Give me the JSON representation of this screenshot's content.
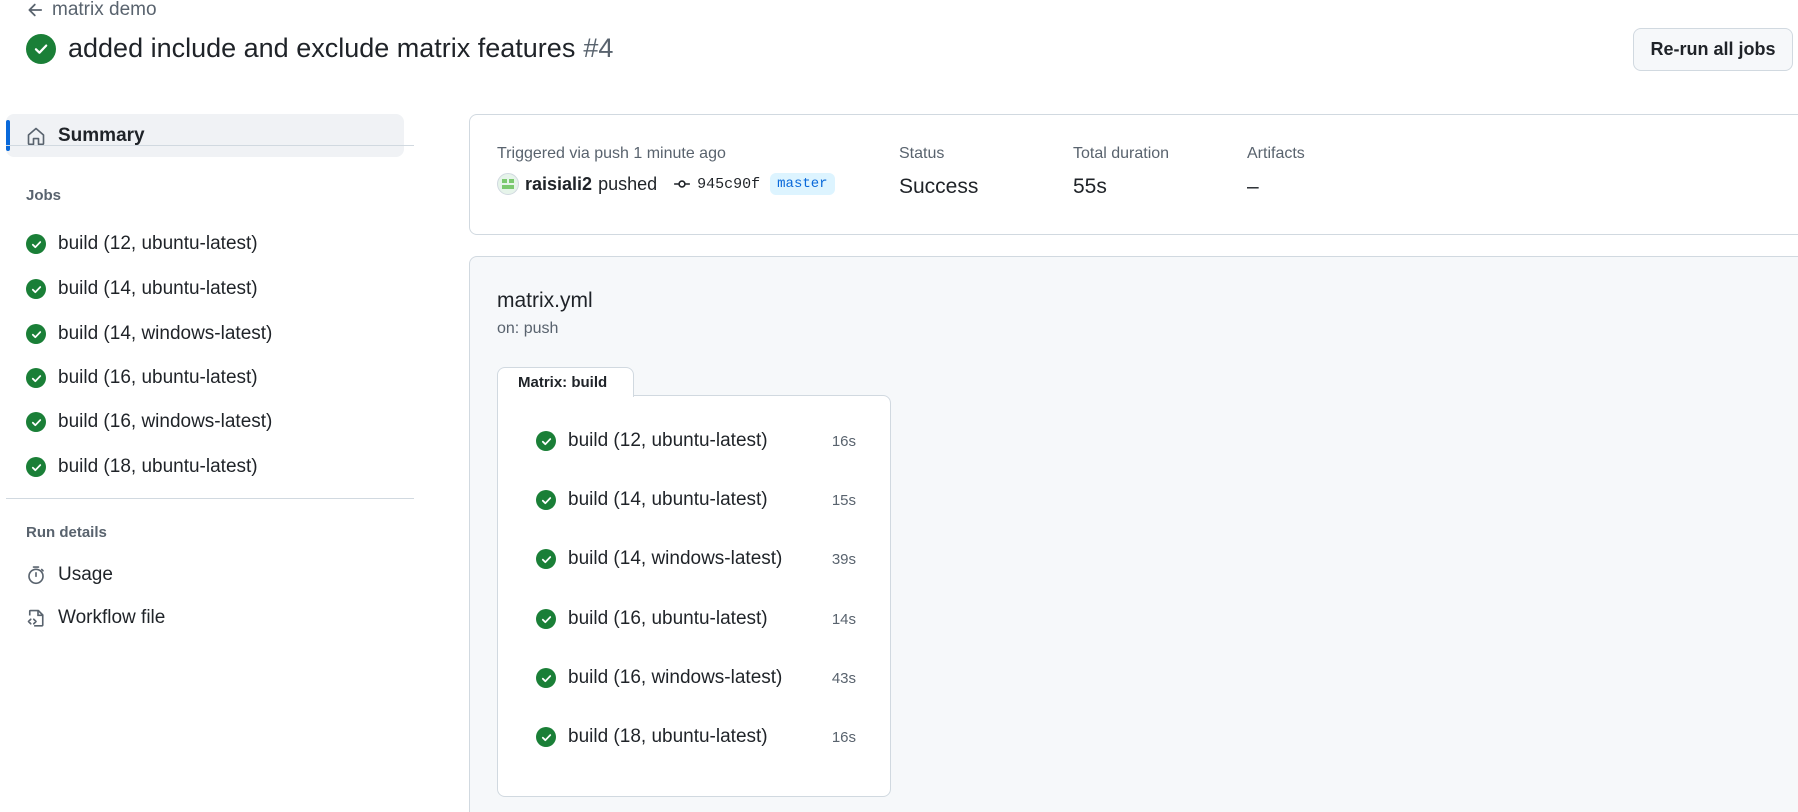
{
  "header": {
    "back_label": "matrix demo",
    "title": "added include and exclude matrix features",
    "run_number": "#4",
    "rerun_label": "Re-run all jobs"
  },
  "sidebar": {
    "summary_label": "Summary",
    "jobs_heading": "Jobs",
    "jobs": [
      {
        "label": "build (12, ubuntu-latest)"
      },
      {
        "label": "build (14, ubuntu-latest)"
      },
      {
        "label": "build (14, windows-latest)"
      },
      {
        "label": "build (16, ubuntu-latest)"
      },
      {
        "label": "build (16, windows-latest)"
      },
      {
        "label": "build (18, ubuntu-latest)"
      }
    ],
    "run_details_heading": "Run details",
    "details": [
      {
        "label": "Usage",
        "icon": "stopwatch-icon"
      },
      {
        "label": "Workflow file",
        "icon": "file-code-icon"
      }
    ]
  },
  "summary": {
    "trigger_label": "Triggered via push 1 minute ago",
    "actor": "raisiali2",
    "action": "pushed",
    "commit": "945c90f",
    "branch": "master",
    "status_label": "Status",
    "status_value": "Success",
    "duration_label": "Total duration",
    "duration_value": "55s",
    "artifacts_label": "Artifacts",
    "artifacts_value": "–"
  },
  "workflow": {
    "name": "matrix.yml",
    "trigger": "on: push",
    "matrix_label": "Matrix: build",
    "jobs": [
      {
        "label": "build (12, ubuntu-latest)",
        "duration": "16s"
      },
      {
        "label": "build (14, ubuntu-latest)",
        "duration": "15s"
      },
      {
        "label": "build (14, windows-latest)",
        "duration": "39s"
      },
      {
        "label": "build (16, ubuntu-latest)",
        "duration": "14s"
      },
      {
        "label": "build (16, windows-latest)",
        "duration": "43s"
      },
      {
        "label": "build (18, ubuntu-latest)",
        "duration": "16s"
      }
    ]
  },
  "colors": {
    "success": "#1a7f37",
    "accent": "#0969da",
    "muted": "#59636e"
  }
}
